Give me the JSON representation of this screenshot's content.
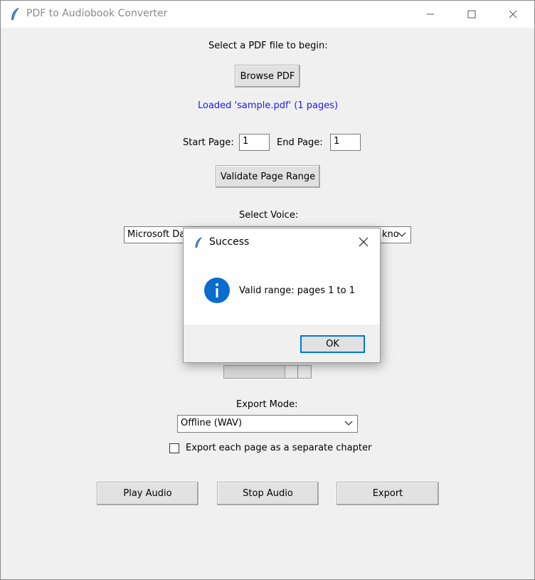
{
  "window": {
    "title": "PDF to Audiobook Converter"
  },
  "main": {
    "select_pdf_prompt": "Select a PDF file to begin:",
    "browse_label": "Browse PDF",
    "loaded_status": "Loaded 'sample.pdf' (1 pages)",
    "start_page_label": "Start Page:",
    "start_page_value": "1",
    "end_page_label": "End Page:",
    "end_page_value": "1",
    "validate_label": "Validate Page Range",
    "select_voice_label": "Select Voice:",
    "voice_left_visible": "Microsoft Da",
    "voice_right_visible": "kno",
    "speed_slider_fraction": 0.72,
    "export_mode_label": "Export Mode:",
    "export_mode_value": "Offline (WAV)",
    "chapter_checkbox_label": "Export each page as a separate chapter",
    "chapter_checkbox_checked": false,
    "play_label": "Play Audio",
    "stop_label": "Stop Audio",
    "export_label": "Export"
  },
  "dialog": {
    "title": "Success",
    "message": "Valid range: pages 1 to 1",
    "ok_label": "OK",
    "icon": "info-icon"
  },
  "colors": {
    "status_blue": "#1a1aff",
    "accent": "#0078d7",
    "info_icon": "#0a6ccf"
  }
}
